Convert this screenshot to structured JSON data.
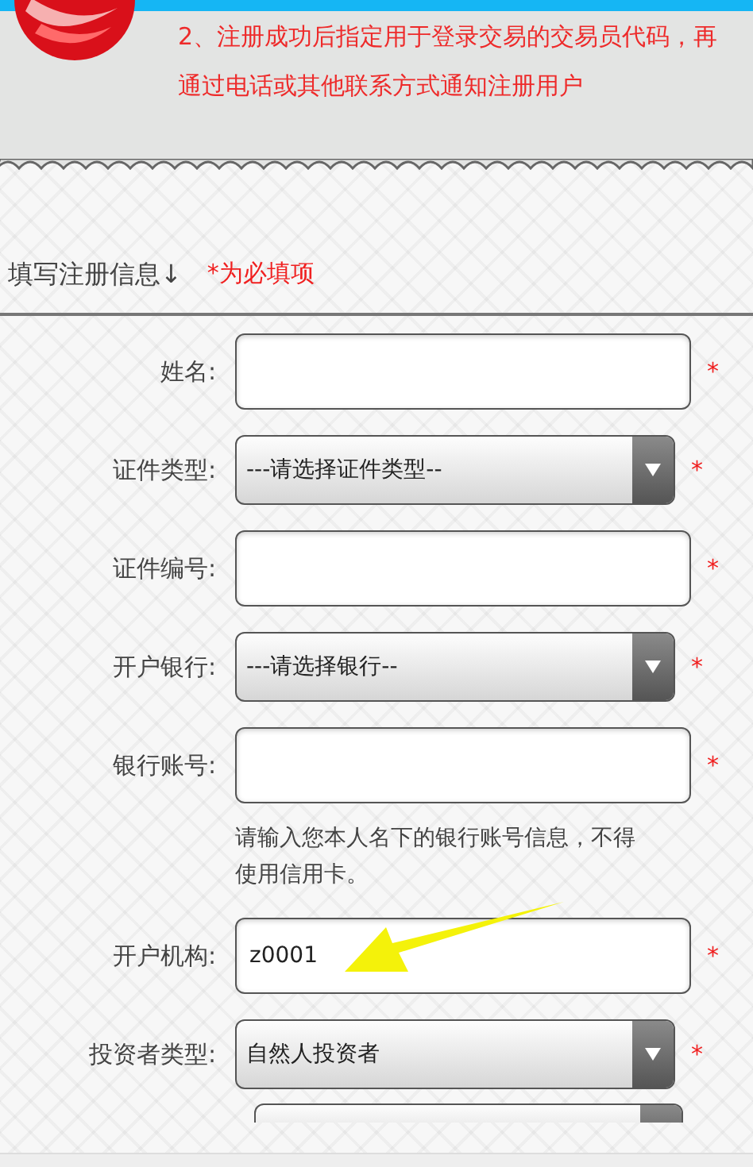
{
  "notice": {
    "text": "2、注册成功后指定用于登录交易的交易员代码，再通过电话或其他联系方式通知注册用户"
  },
  "section": {
    "title": "填写注册信息↓",
    "required_hint": "*为必填项"
  },
  "fields": [
    {
      "kind": "input",
      "label": "姓名:",
      "required_mark": "*"
    },
    {
      "kind": "select",
      "label": "证件类型:",
      "value": "---请选择证件类型--",
      "required_mark": "*"
    },
    {
      "kind": "input",
      "label": "证件编号:",
      "required_mark": "*"
    },
    {
      "kind": "select",
      "label": "开户银行:",
      "value": "---请选择银行--",
      "required_mark": "*"
    },
    {
      "kind": "input",
      "label": "银行账号:",
      "required_mark": "*"
    },
    {
      "kind": "note",
      "text": "请输入您本人名下的银行账号信息，不得使用信用卡。"
    },
    {
      "kind": "input",
      "label": "开户机构:",
      "value": "z0001",
      "required_mark": "*"
    },
    {
      "kind": "select",
      "label": "投资者类型:",
      "value": "自然人投资者",
      "required_mark": "*"
    },
    {
      "kind": "select_partial"
    }
  ]
}
